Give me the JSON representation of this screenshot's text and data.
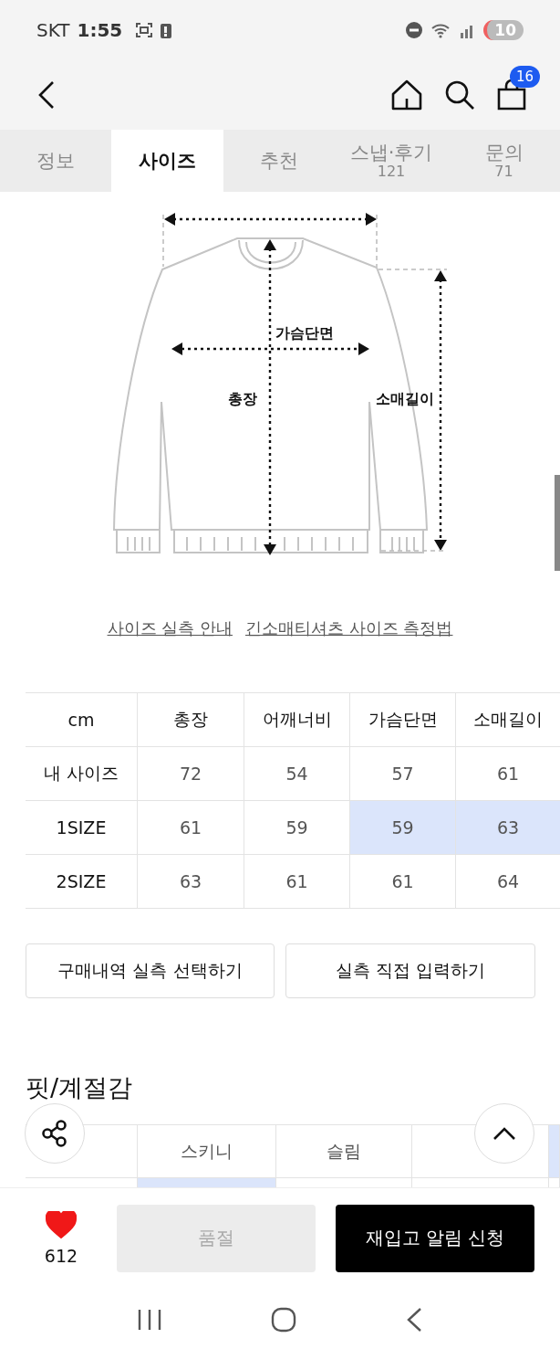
{
  "status_bar": {
    "carrier": "SKT",
    "time": "1:55",
    "battery": "10"
  },
  "nav": {
    "cart_count": "16"
  },
  "tabs": [
    {
      "label": "정보",
      "selected": false
    },
    {
      "label": "사이즈",
      "selected": true
    },
    {
      "label": "추천",
      "selected": false
    },
    {
      "label": "스냅·후기",
      "count": "121",
      "selected": false
    },
    {
      "label": "문의",
      "count": "71",
      "selected": false
    }
  ],
  "diagram": {
    "labels": {
      "chest": "가슴단면",
      "length": "총장",
      "sleeve": "소매길이"
    }
  },
  "links": [
    "사이즈 실측 안내",
    "긴소매티셔츠 사이즈 측정법"
  ],
  "size_table": {
    "columns": [
      "cm",
      "총장",
      "어깨너비",
      "가슴단면",
      "소매길이"
    ],
    "rows": [
      [
        {
          "text": "내 사이즈",
          "highlighted": false
        },
        {
          "text": "72",
          "highlighted": false
        },
        {
          "text": "54",
          "highlighted": false
        },
        {
          "text": "57",
          "highlighted": false
        },
        {
          "text": "61",
          "highlighted": false
        }
      ],
      [
        {
          "text": "1SIZE",
          "highlighted": false
        },
        {
          "text": "61",
          "highlighted": false
        },
        {
          "text": "59",
          "highlighted": false
        },
        {
          "text": "59",
          "highlighted": true
        },
        {
          "text": "63",
          "highlighted": true
        }
      ],
      [
        {
          "text": "2SIZE",
          "highlighted": false
        },
        {
          "text": "63",
          "highlighted": false
        },
        {
          "text": "61",
          "highlighted": false
        },
        {
          "text": "61",
          "highlighted": false
        },
        {
          "text": "64",
          "highlighted": false
        }
      ]
    ]
  },
  "actions": [
    "구매내역 실측 선택하기",
    "실측 직접 입력하기"
  ],
  "fit_section": {
    "title": "핏/계절감",
    "header": [
      {
        "text": "스키니",
        "highlighted": false
      },
      {
        "text": "슬림",
        "highlighted": false
      },
      {
        "highlighted": false
      },
      {
        "highlighted": true
      }
    ],
    "row": [
      {
        "highlighted": true
      },
      {
        "highlighted": false
      },
      {
        "highlighted": false
      },
      {
        "highlighted": false
      }
    ]
  },
  "bottom_bar": {
    "likes": "612",
    "liked": true,
    "sold_out_button": "품절",
    "restock_button": "재입고 알림 신청"
  }
}
